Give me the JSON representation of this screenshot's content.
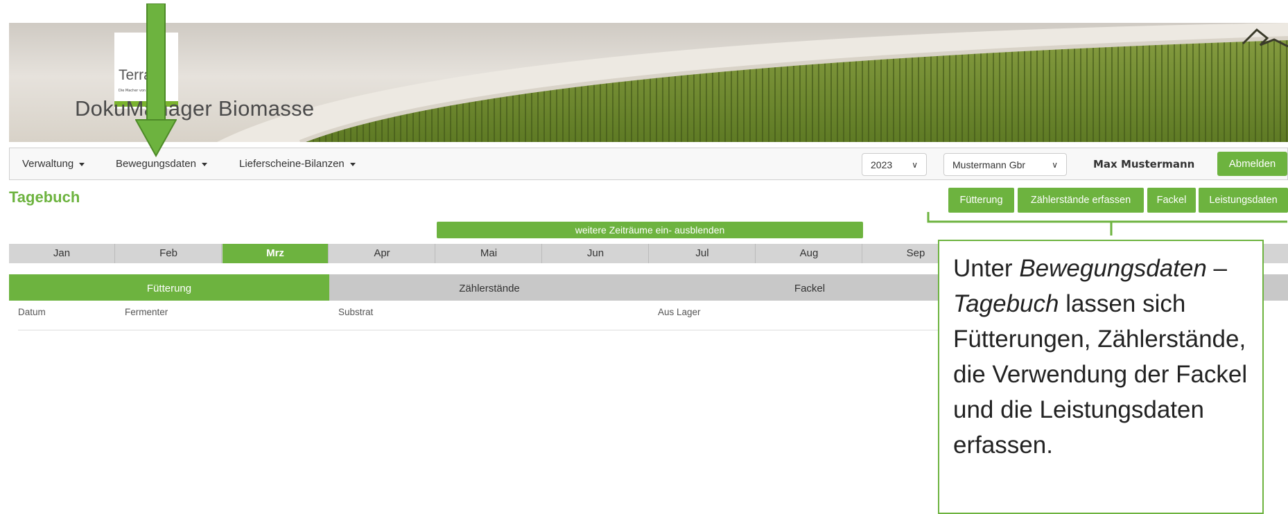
{
  "banner": {
    "logo_text": "TerraV",
    "logo_tagline": "Die Macher von",
    "app_title": "DokuManager Biomasse"
  },
  "navbar": {
    "menu": [
      "Verwaltung",
      "Bewegungsdaten",
      "Lieferscheine-Bilanzen"
    ],
    "year_select": "2023",
    "company_select": "Mustermann Gbr",
    "user_name": "Max Mustermann",
    "logout_label": "Abmelden"
  },
  "page": {
    "title": "Tagebuch",
    "action_buttons": [
      "Fütterung",
      "Zählerstände erfassen",
      "Fackel",
      "Leistungsdaten"
    ],
    "toggle_label": "weitere Zeiträume ein- ausblenden",
    "months": [
      "Jan",
      "Feb",
      "Mrz",
      "Apr",
      "Mai",
      "Jun",
      "Jul",
      "Aug",
      "Sep"
    ],
    "active_month": "Mrz",
    "tabs": [
      "Fütterung",
      "Zählerstände",
      "Fackel"
    ],
    "active_tab": "Fütterung",
    "table_headers": [
      "Datum",
      "Fermenter",
      "Substrat",
      "Aus Lager"
    ]
  },
  "callout": {
    "prefix": "Unter ",
    "em1": "Bewegungsdaten",
    "dash": " –",
    "em2": "Tagebuch",
    "rest": " lassen sich Fütterungen, Zählerstände, die Verwendung der Fackel und die Leistungsdaten erfassen."
  },
  "colors": {
    "accent": "#6db33f",
    "tab_inactive": "#c8c8c8",
    "month_bar": "#d4d4d4"
  }
}
